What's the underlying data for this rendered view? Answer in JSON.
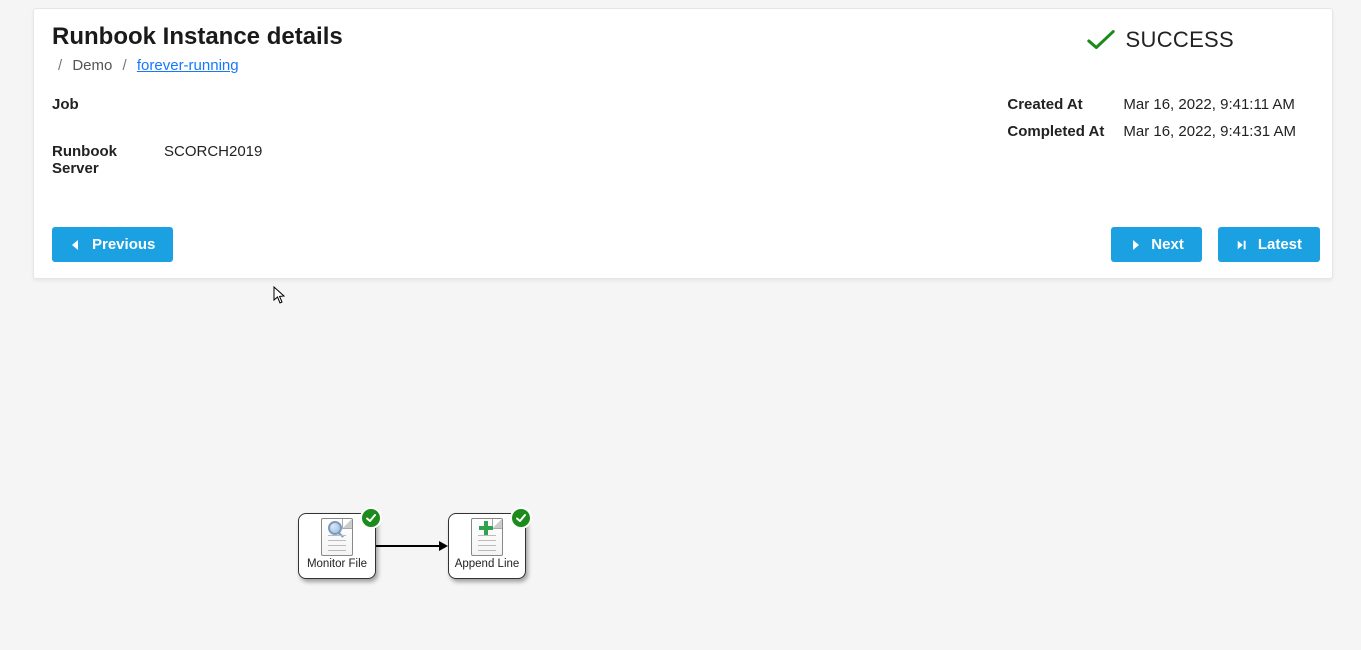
{
  "header": {
    "title": "Runbook Instance details",
    "breadcrumb": [
      {
        "text": "Demo",
        "link": false
      },
      {
        "text": "forever-running",
        "link": true
      }
    ]
  },
  "status": {
    "label": "SUCCESS"
  },
  "details": {
    "job_label": "Job",
    "job_value": "",
    "server_label": "Runbook Server",
    "server_value": "SCORCH2019",
    "created_label": "Created At",
    "created_value": "Mar 16, 2022, 9:41:11 AM",
    "completed_label": "Completed At",
    "completed_value": "Mar 16, 2022, 9:41:31 AM"
  },
  "buttons": {
    "previous": "Previous",
    "next": "Next",
    "latest": "Latest"
  },
  "diagram": {
    "nodes": [
      {
        "label": "Monitor File",
        "icon": "monitor",
        "status": "success"
      },
      {
        "label": "Append Line",
        "icon": "append",
        "status": "success"
      }
    ]
  }
}
